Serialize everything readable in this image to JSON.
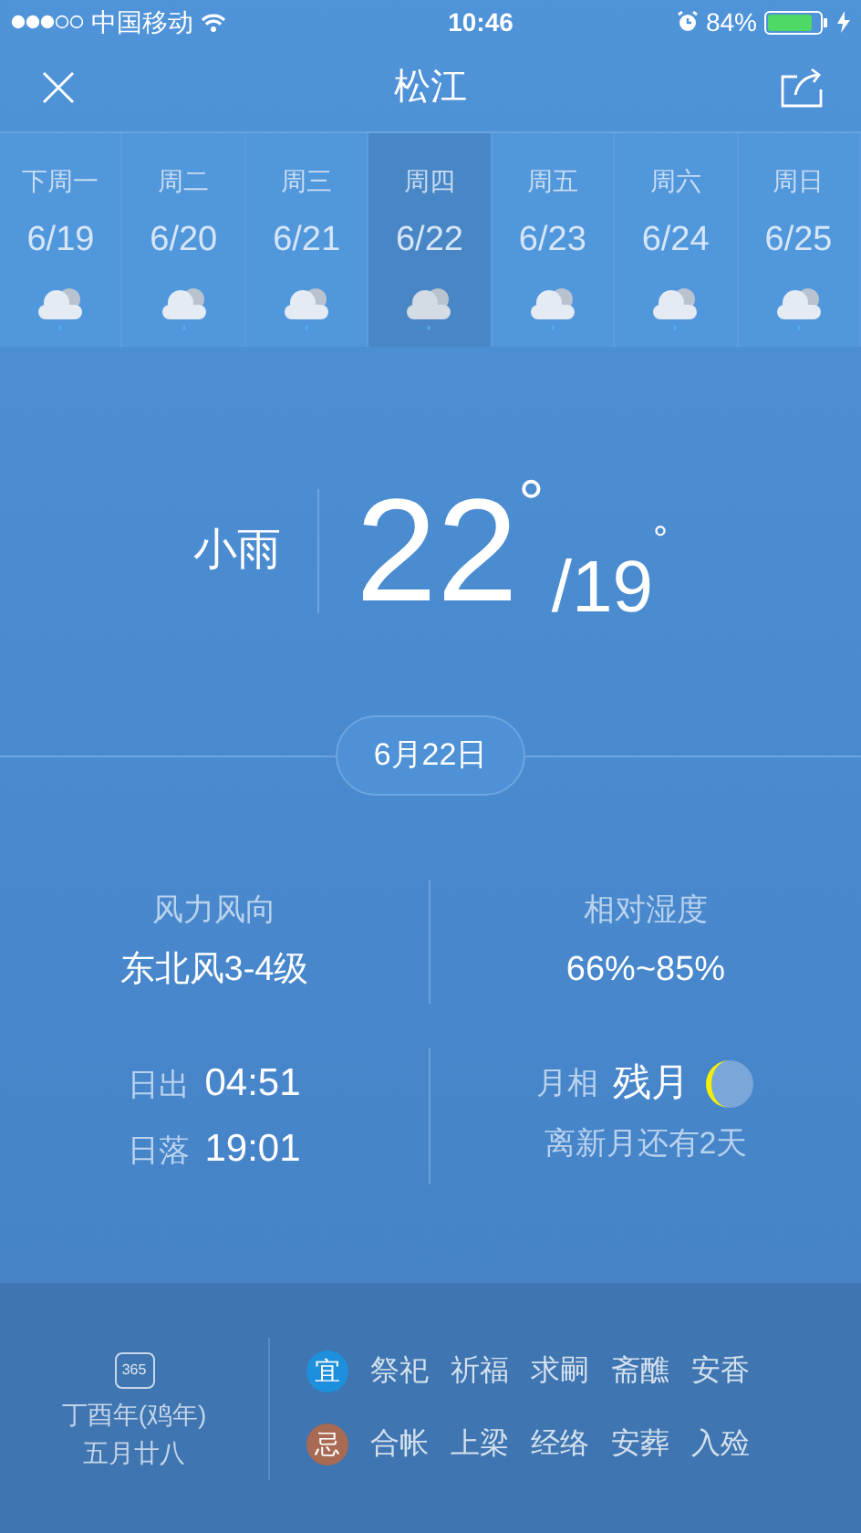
{
  "status_bar": {
    "carrier": "中国移动",
    "time": "10:46",
    "battery": "84%"
  },
  "header": {
    "title": "松江"
  },
  "forecast": [
    {
      "weekday": "下周一",
      "date": "6/19",
      "selected": false
    },
    {
      "weekday": "周二",
      "date": "6/20",
      "selected": false
    },
    {
      "weekday": "周三",
      "date": "6/21",
      "selected": false
    },
    {
      "weekday": "周四",
      "date": "6/22",
      "selected": true
    },
    {
      "weekday": "周五",
      "date": "6/23",
      "selected": false
    },
    {
      "weekday": "周六",
      "date": "6/24",
      "selected": false
    },
    {
      "weekday": "周日",
      "date": "6/25",
      "selected": false
    }
  ],
  "current": {
    "condition": "小雨",
    "high": "22",
    "high_unit": "°",
    "low": "/19",
    "low_unit": "°"
  },
  "date_pill": "6月22日",
  "details": {
    "wind_label": "风力风向",
    "wind_value": "东北风3-4级",
    "humidity_label": "相对湿度",
    "humidity_value": "66%~85%",
    "sunrise_label": "日出",
    "sunrise": "04:51",
    "sunset_label": "日落",
    "sunset": "19:01",
    "moon_label": "月相",
    "moon_phase": "残月",
    "moon_note": "离新月还有2天"
  },
  "almanac": {
    "calendar_icon_text": "365",
    "lunar_year": "丁酉年(鸡年)",
    "lunar_date": "五月廿八",
    "rows": [
      {
        "badge": "宜",
        "color": "#1e8fdc",
        "items": [
          "祭祀",
          "祈福",
          "求嗣",
          "斋醮",
          "安香"
        ]
      },
      {
        "badge": "忌",
        "color": "#a86a52",
        "items": [
          "合帐",
          "上梁",
          "经络",
          "安葬",
          "入殓"
        ]
      }
    ]
  }
}
